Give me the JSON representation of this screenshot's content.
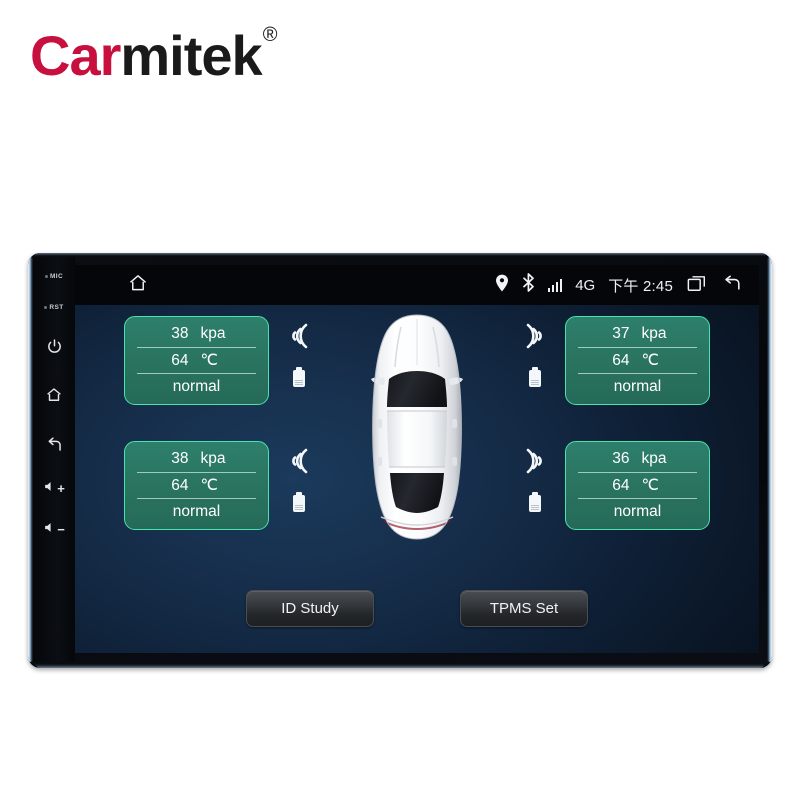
{
  "brand": {
    "name_accent": "Car",
    "name_rest": "mitek",
    "registered_mark": "®"
  },
  "device": {
    "hardware_buttons": [
      {
        "name": "mic-label",
        "label": "MIC"
      },
      {
        "name": "reset-label",
        "label": "RST"
      },
      {
        "name": "power-button",
        "label": "power-icon"
      },
      {
        "name": "home-button",
        "label": "home-icon"
      },
      {
        "name": "back-button",
        "label": "back-icon"
      },
      {
        "name": "volume-up-button",
        "label": "+"
      },
      {
        "name": "volume-down-button",
        "label": "−"
      }
    ]
  },
  "statusbar": {
    "home_icon": "home-icon",
    "location_icon": "location-pin-icon",
    "bluetooth_icon": "bluetooth-icon",
    "signal_icon": "signal-bars-icon",
    "network": "4G",
    "time": "下午 2:45",
    "recents_icon": "recent-apps-icon",
    "back_icon": "back-arrow-icon"
  },
  "tpms": {
    "pressure_unit": "kpa",
    "temperature_unit": "℃",
    "tires": [
      {
        "position": "front-left",
        "pressure": "38",
        "pressure_unit": "kpa",
        "temperature": "64",
        "temperature_unit": "℃",
        "status": "normal"
      },
      {
        "position": "front-right",
        "pressure": "37",
        "pressure_unit": "kpa",
        "temperature": "64",
        "temperature_unit": "℃",
        "status": "normal"
      },
      {
        "position": "rear-left",
        "pressure": "38",
        "pressure_unit": "kpa",
        "temperature": "64",
        "temperature_unit": "℃",
        "status": "normal"
      },
      {
        "position": "rear-right",
        "pressure": "36",
        "pressure_unit": "kpa",
        "temperature": "64",
        "temperature_unit": "℃",
        "status": "normal"
      }
    ],
    "sensor_icons": {
      "signal": "sensor-wave-icon",
      "battery": "sensor-battery-icon"
    },
    "vehicle_icon": "car-top-view-icon"
  },
  "buttons": {
    "id_study": "ID Study",
    "tpms_set": "TPMS Set"
  },
  "colors": {
    "brand_accent": "#c8103f",
    "panel_fill": "#2d7f6c",
    "panel_border": "#49e3ad",
    "screen_bg": "#15304f"
  }
}
